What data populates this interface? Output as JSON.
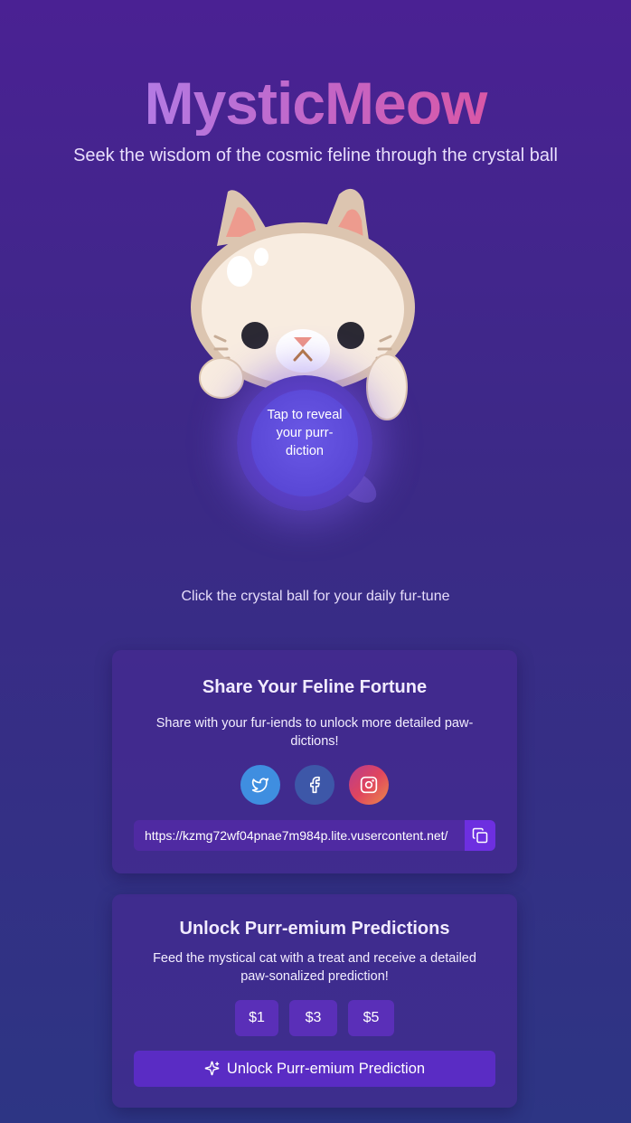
{
  "header": {
    "title": "MysticMeow",
    "subtitle": "Seek the wisdom of the cosmic feline through the crystal ball"
  },
  "crystal_ball": {
    "label": "Tap to reveal your purr-diction",
    "hint": "Click the crystal ball for your daily fur-tune"
  },
  "share": {
    "title": "Share Your Feline Fortune",
    "description": "Share with your fur-iends to unlock more detailed paw-dictions!",
    "icons": [
      "twitter-icon",
      "facebook-icon",
      "instagram-icon"
    ],
    "link": "https://kzmg72wf04pnae7m984p.lite.vusercontent.net/"
  },
  "premium": {
    "title": "Unlock Purr-emium Predictions",
    "description": "Feed the mystical cat with a treat and receive a detailed paw-sonalized prediction!",
    "amounts": [
      "$1",
      "$3",
      "$5"
    ],
    "button_label": "Unlock Purr-emium Prediction"
  },
  "colors": {
    "background_top": "#4a2193",
    "background_bottom": "#2d3584",
    "accent": "#6d2fe0",
    "title_gradient": [
      "#a78bfa",
      "#c266c8",
      "#ec4b8a"
    ]
  }
}
